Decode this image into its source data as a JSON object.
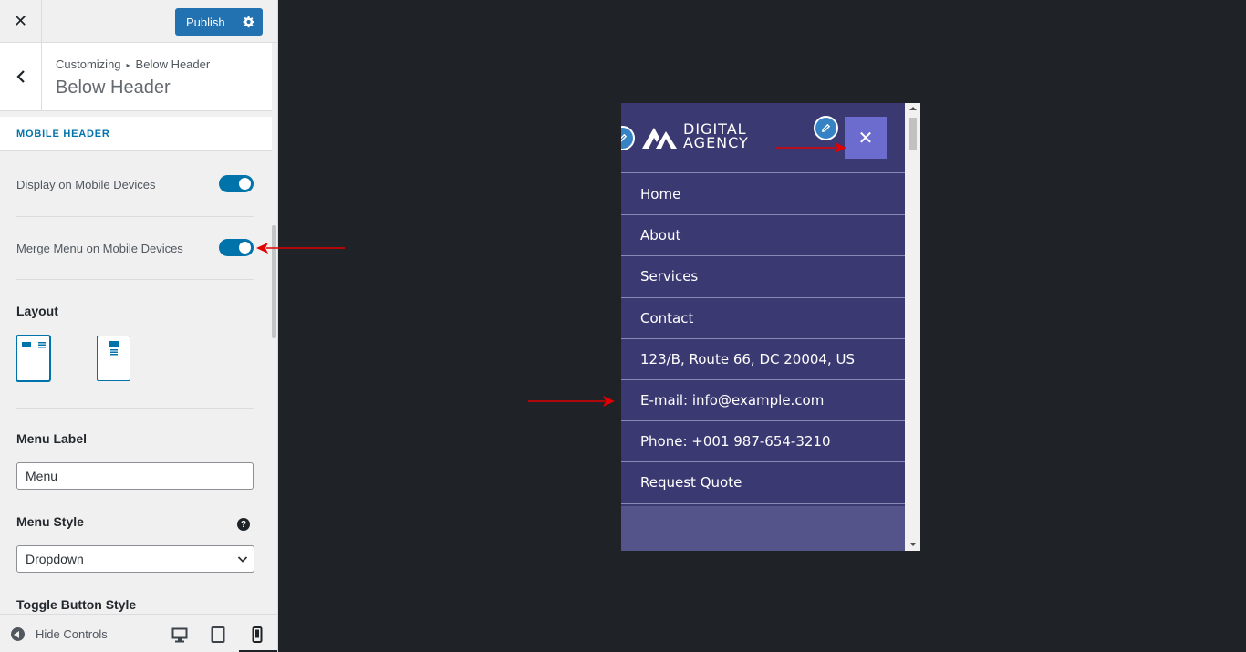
{
  "topbar": {
    "close_icon": "close-icon",
    "publish_label": "Publish",
    "settings_icon": "gear-icon"
  },
  "section": {
    "breadcrumb_root": "Customizing",
    "breadcrumb_current": "Below Header",
    "title": "Below Header"
  },
  "panel": {
    "heading": "MOBILE HEADER",
    "display_mobile_label": "Display on Mobile Devices",
    "display_mobile_enabled": true,
    "merge_menu_label": "Merge Menu on Mobile Devices",
    "merge_menu_enabled": true,
    "layout_label": "Layout",
    "menu_label_title": "Menu Label",
    "menu_label_value": "Menu",
    "menu_style_title": "Menu Style",
    "menu_style_help": "?",
    "menu_style_value": "Dropdown",
    "toggle_style_title": "Toggle Button Style"
  },
  "footer": {
    "hide_controls_label": "Hide Controls",
    "devices": [
      "desktop-icon",
      "tablet-icon",
      "mobile-icon"
    ],
    "active_device": "mobile"
  },
  "preview": {
    "logo_line1": "DIGITAL",
    "logo_line2": "AGENCY",
    "close_glyph": "✕",
    "menu_items": [
      "Home",
      "About",
      "Services",
      "Contact",
      "123/B, Route 66, DC 20004, US",
      "E-mail: info@example.com",
      "Phone: +001 987-654-3210",
      "Request Quote"
    ]
  },
  "colors": {
    "accent": "#0073aa",
    "publish": "#2271b1",
    "site_bg": "#3b3972",
    "menu_toggle": "#6c6ccf",
    "annotation_arrow": "#e00000",
    "canvas_bg": "#1f2226"
  }
}
